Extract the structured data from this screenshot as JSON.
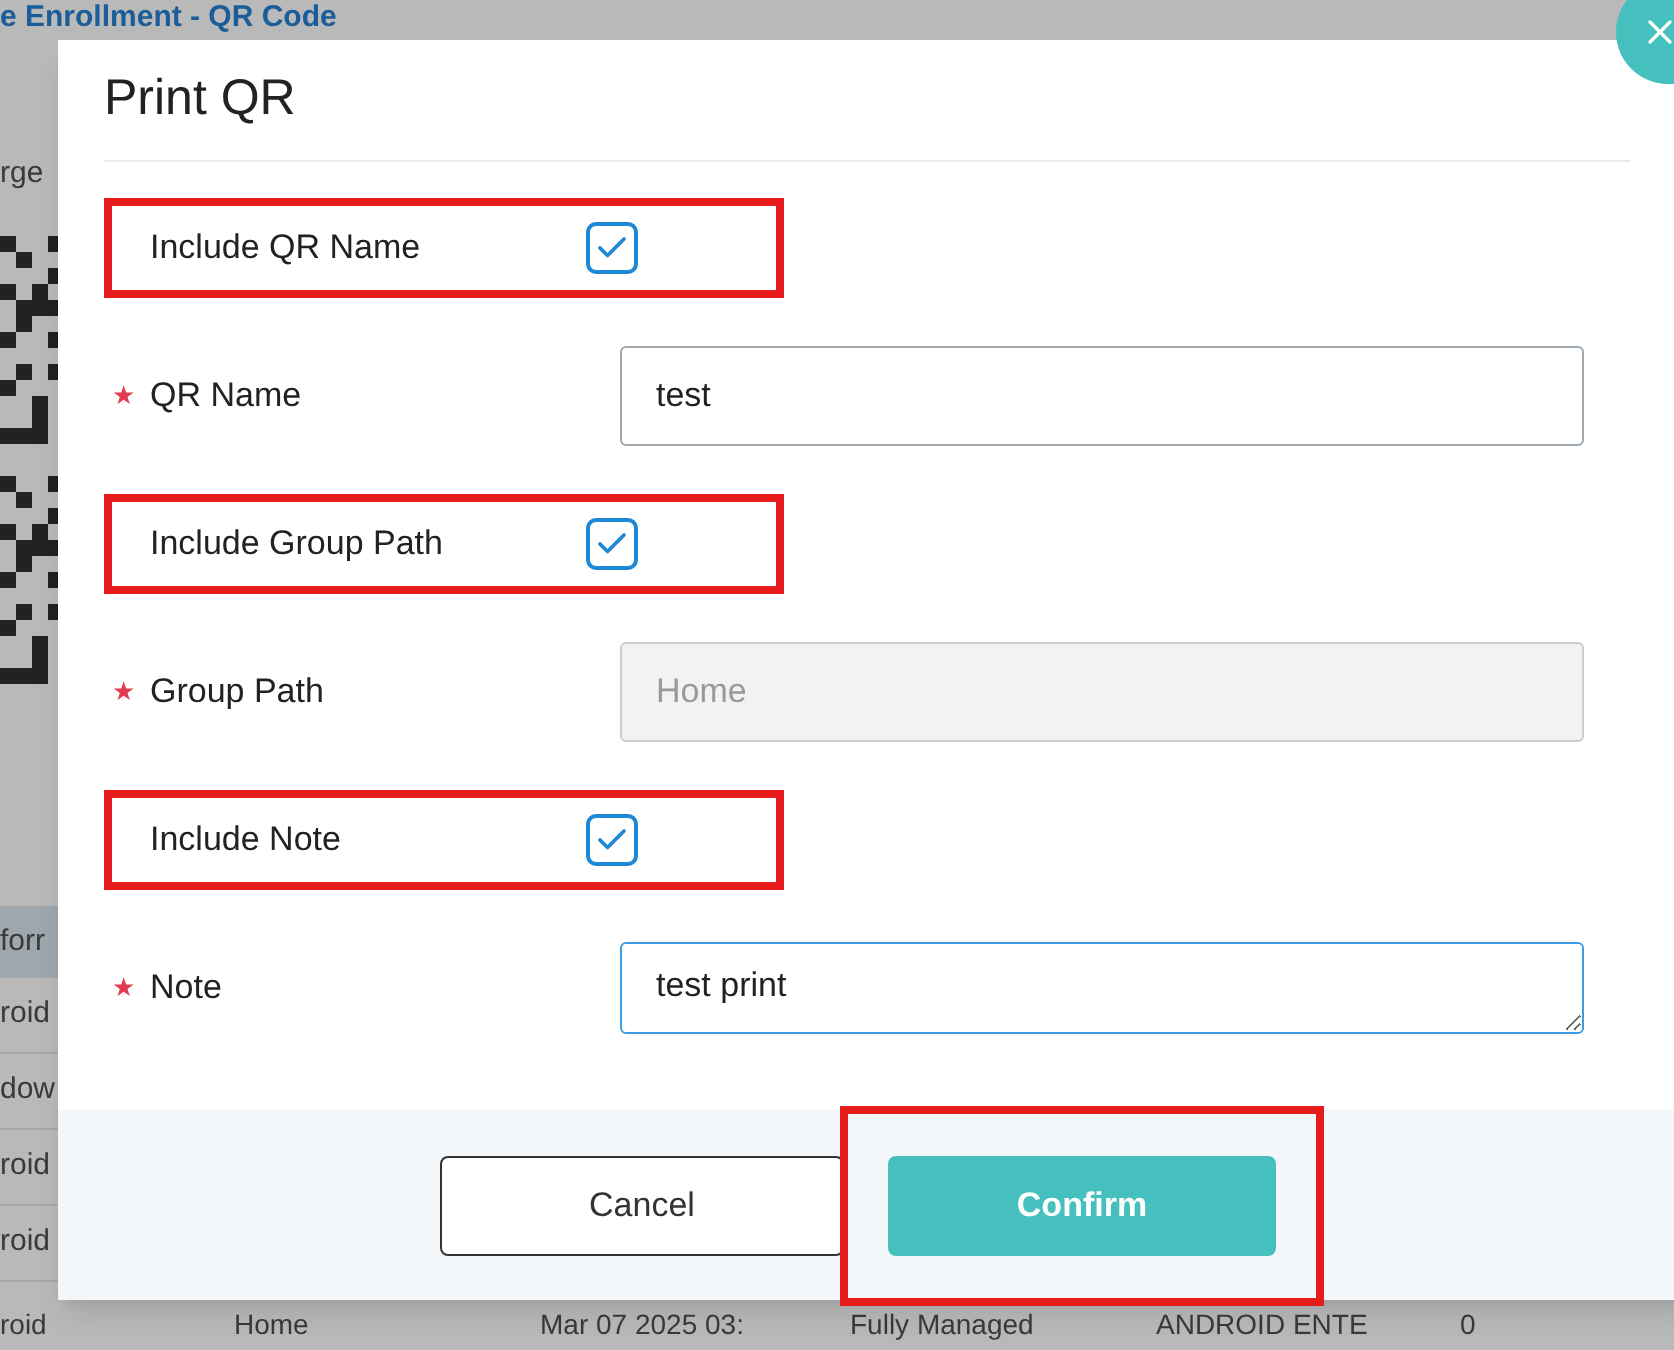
{
  "background": {
    "title": "e Enrollment - QR Code",
    "side_texts": [
      "rge"
    ],
    "table_header": "forr",
    "table_rows": [
      "roid",
      "dow",
      "roid",
      "roid"
    ],
    "bottom_row": [
      "roid",
      "Home",
      "Mar 07 2025 03:",
      "Fully Managed",
      "ANDROID ENTE",
      "0"
    ]
  },
  "dialog": {
    "title": "Print QR",
    "fields": [
      {
        "kind": "checkbox",
        "label": "Include QR Name",
        "checked": true,
        "highlighted": true
      },
      {
        "kind": "input",
        "label": "QR Name",
        "required_mark": "★",
        "value": "test",
        "disabled": false
      },
      {
        "kind": "checkbox",
        "label": "Include Group Path",
        "checked": true,
        "highlighted": true
      },
      {
        "kind": "input",
        "label": "Group Path",
        "required_mark": "★",
        "value": "Home",
        "disabled": true
      },
      {
        "kind": "checkbox",
        "label": "Include Note",
        "checked": true,
        "highlighted": true
      },
      {
        "kind": "textarea",
        "label": "Note",
        "required_mark": "★",
        "value": "test print",
        "focused": true
      }
    ],
    "buttons": [
      {
        "label": "Cancel",
        "kind": "secondary",
        "highlighted": false
      },
      {
        "label": "Confirm",
        "kind": "primary",
        "highlighted": true
      }
    ]
  }
}
